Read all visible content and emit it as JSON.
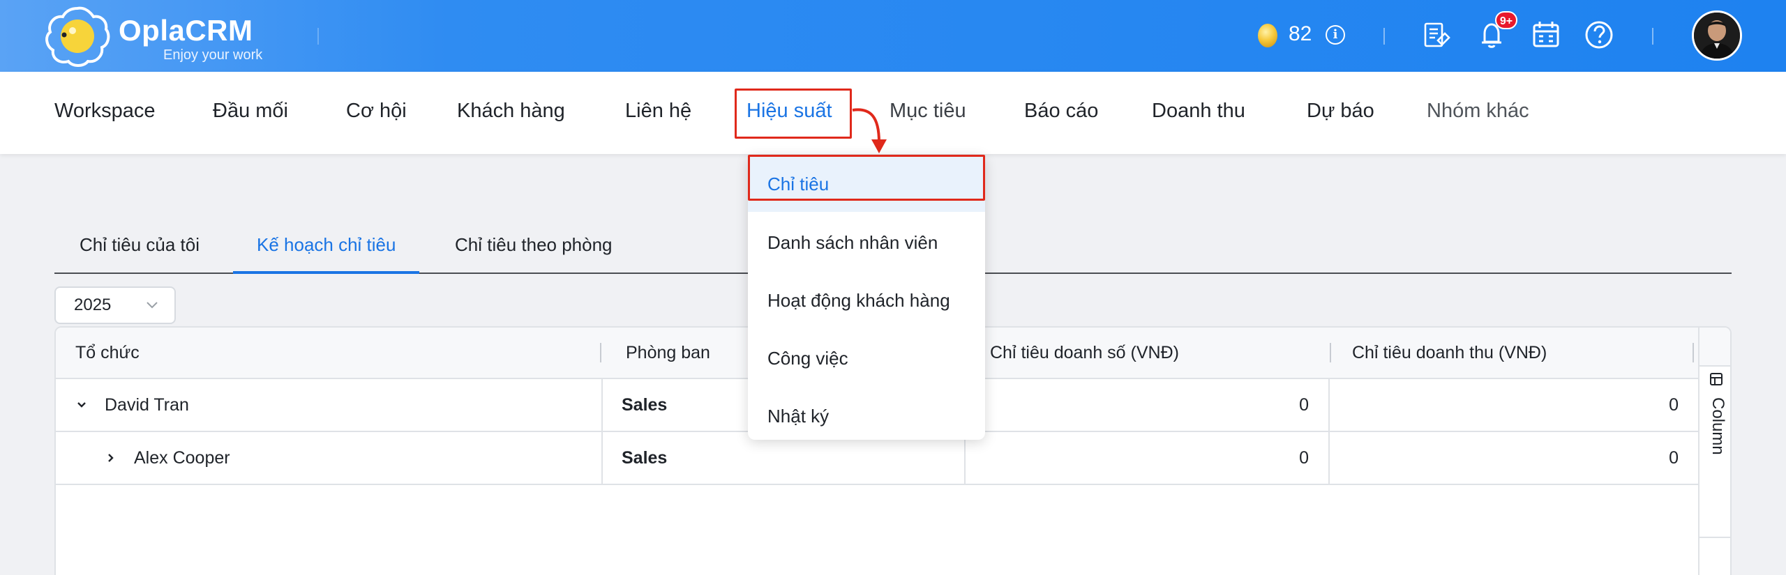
{
  "brand": {
    "name": "OplaCRM",
    "tagline": "Enjoy your work"
  },
  "header": {
    "coins": "82",
    "notification_badge": "9+",
    "icons": [
      "coin-icon",
      "info-icon",
      "report-icon",
      "bell-icon",
      "calendar-icon",
      "help-icon",
      "avatar"
    ]
  },
  "nav": {
    "items": [
      "Workspace",
      "Đầu mối",
      "Cơ hội",
      "Khách hàng",
      "Liên hệ",
      "Hiệu suất",
      "Mục tiêu",
      "Báo cáo",
      "Doanh thu",
      "Dự báo",
      "Nhóm khác"
    ],
    "active": "Hiệu suất"
  },
  "dropdown": {
    "items": [
      "Chỉ tiêu",
      "Danh sách nhân viên",
      "Hoạt động khách hàng",
      "Công việc",
      "Nhật ký"
    ],
    "active": "Chỉ tiêu"
  },
  "tabs": {
    "items": [
      "Chỉ tiêu của tôi",
      "Kế hoạch chỉ tiêu",
      "Chỉ tiêu theo phòng"
    ],
    "active": "Kế hoạch chỉ tiêu"
  },
  "filter": {
    "year": "2025"
  },
  "table": {
    "headers": [
      "Tổ chức",
      "Phòng ban",
      "Chỉ tiêu doanh số (VNĐ)",
      "Chỉ tiêu doanh thu (VNĐ)"
    ],
    "rows": [
      {
        "name": "David Tran",
        "department": "Sales",
        "sales_target": "0",
        "revenue_target": "0",
        "expanded": true
      },
      {
        "name": "Alex Cooper",
        "department": "Sales",
        "sales_target": "0",
        "revenue_target": "0",
        "expanded": false
      }
    ],
    "column_button": "Column"
  },
  "colors": {
    "primary": "#1a74e4",
    "highlight": "#e0291b",
    "badge": "#e8192c"
  }
}
